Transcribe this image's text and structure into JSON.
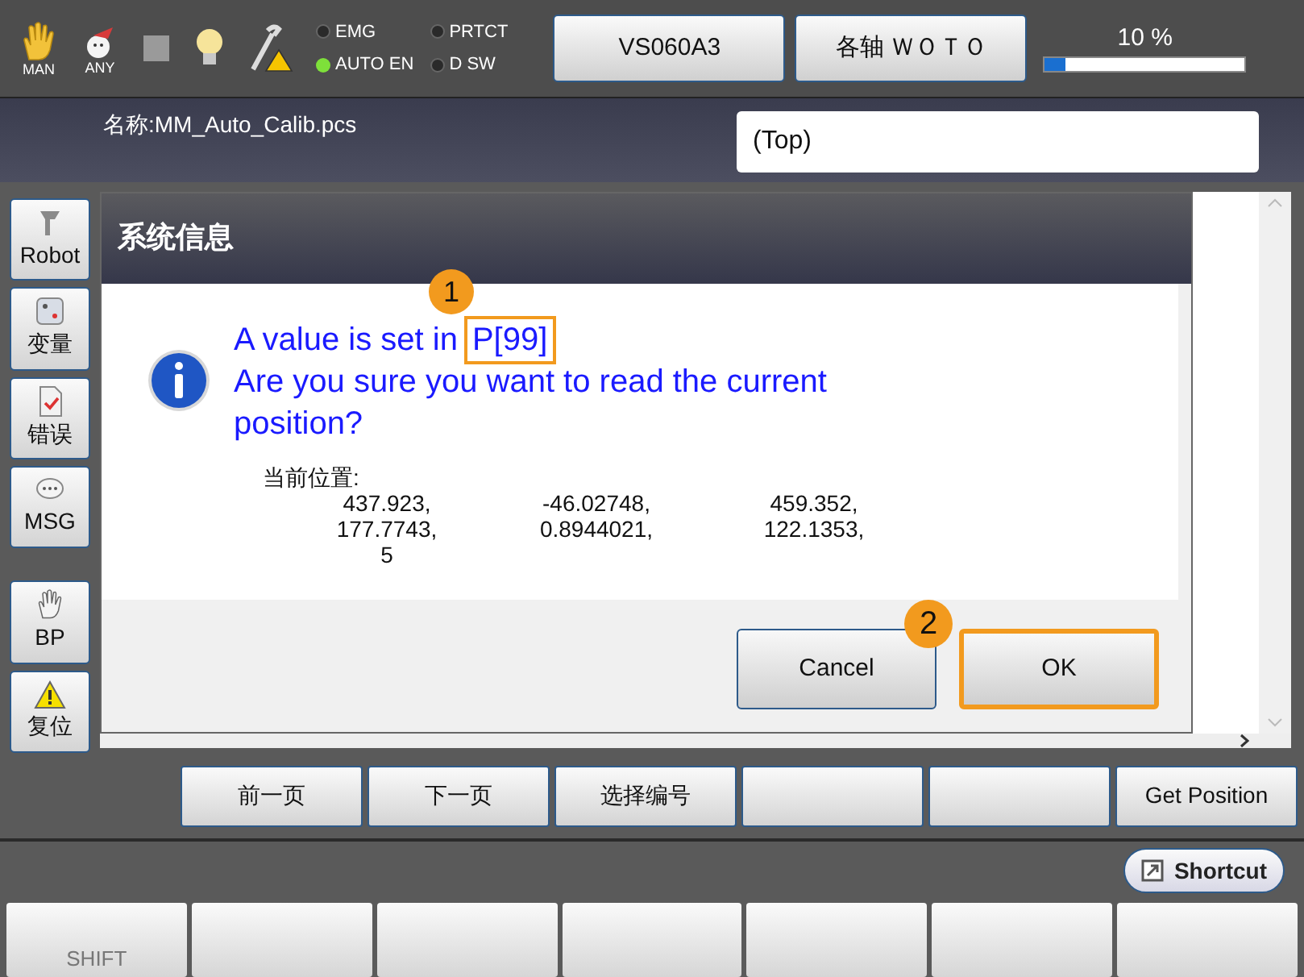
{
  "top_bar": {
    "mode_icons": [
      {
        "kind": "hand",
        "label": "MAN"
      },
      {
        "kind": "robot",
        "label": "ANY"
      },
      {
        "kind": "square"
      },
      {
        "kind": "bulb"
      },
      {
        "kind": "wrench"
      }
    ],
    "indicators": [
      {
        "label": "EMG",
        "on": false
      },
      {
        "label": "AUTO EN",
        "on": true
      },
      {
        "label": "PRTCT",
        "on": false
      },
      {
        "label": "D SW",
        "on": false
      }
    ],
    "buttons": [
      "VS060A3",
      "各轴 ＷＯＴＯ"
    ],
    "speed": {
      "reading": "10 %",
      "level": 0.1
    }
  },
  "header": {
    "name": "名称:MM_Auto_Calib.pcs",
    "field_value": "(Top)"
  },
  "sidebar": [
    {
      "kind": "robot",
      "label": "Robot"
    },
    {
      "kind": "dice",
      "label": "变量"
    },
    {
      "kind": "doc",
      "label": "错误"
    },
    {
      "kind": "chat",
      "label": "MSG"
    },
    {
      "kind": "hand",
      "label": "BP"
    },
    {
      "kind": "warning",
      "label": "复位"
    }
  ],
  "dialog": {
    "title": "系统信息",
    "message_start": "A value is set in",
    "highlight": "P[99]",
    "question": "Are you sure you want to read the current position?",
    "position_label": "当前位置:",
    "position_rows": [
      [
        "437.923,",
        "-46.02748,",
        "459.352,"
      ],
      [
        "177.7743,",
        "0.8944021,",
        "122.1353,"
      ],
      [
        "5"
      ]
    ],
    "buttons": [
      {
        "label": "Cancel",
        "highlighted": false
      },
      {
        "label": "OK",
        "highlighted": true
      }
    ]
  },
  "annotations": [
    "1",
    "2"
  ],
  "function_keys": [
    {
      "kind": "label",
      "label": "前一页"
    },
    {
      "kind": "label",
      "label": "下一页"
    },
    {
      "kind": "label",
      "label": "选择编号"
    },
    {
      "kind": "blank"
    },
    {
      "kind": "blank"
    },
    {
      "kind": "label",
      "label": "Get Position"
    }
  ],
  "shortcut": "Shortcut",
  "bottom_keys": [
    {
      "kind": "label",
      "label": "SHIFT",
      "disabled": true
    },
    {
      "kind": "blank"
    },
    {
      "kind": "blank"
    },
    {
      "kind": "blank"
    },
    {
      "kind": "blank"
    },
    {
      "kind": "blank"
    },
    {
      "kind": "blank"
    }
  ]
}
